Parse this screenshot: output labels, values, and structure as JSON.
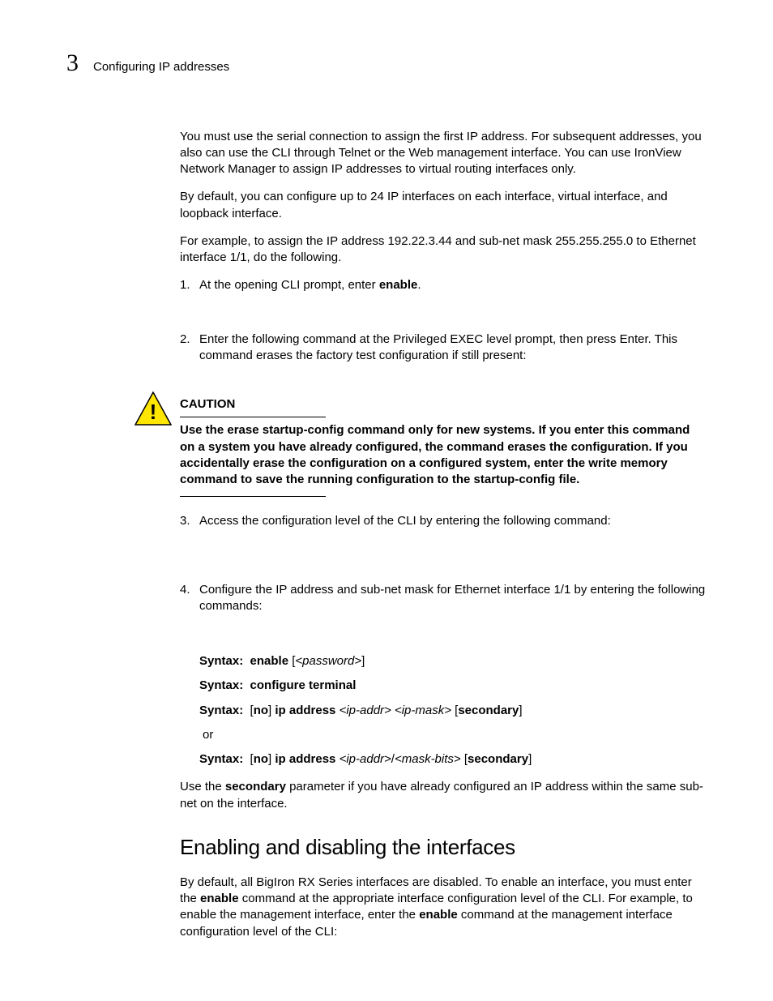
{
  "header": {
    "chapter_number": "3",
    "chapter_title": "Configuring IP addresses"
  },
  "body": {
    "p1": "You must use the serial connection to assign the first IP address. For subsequent addresses, you also can use the CLI through Telnet or the Web management interface. You can use IronView Network Manager to assign IP addresses to virtual routing interfaces only.",
    "p2": "By default, you can configure up to 24 IP interfaces on each interface, virtual interface, and loopback interface.",
    "p3": "For example, to assign the IP address 192.22.3.44 and sub-net mask 255.255.255.0 to Ethernet interface 1/1, do the following.",
    "steps": {
      "s1_num": "1.",
      "s1_a": "At the opening CLI prompt, enter ",
      "s1_b": "enable",
      "s1_c": ".",
      "s2_num": "2.",
      "s2": "Enter the following command at the Privileged EXEC level prompt, then press Enter. This command erases the factory test configuration if still present:",
      "s3_num": "3.",
      "s3": "Access the configuration level of the CLI by entering the following command:",
      "s4_num": "4.",
      "s4": "Configure the IP address and sub-net mask for Ethernet interface 1/1 by entering the following commands:"
    },
    "caution": {
      "label": "CAUTION",
      "text": "Use the erase startup-config command only for new systems. If you enter this command on a system you have already configured, the command erases the configuration. If you accidentally erase the configuration on a configured system, enter the write memory command to save the running configuration to the startup-config file."
    },
    "syntax": {
      "label": "Syntax:",
      "s1_a": "enable",
      "s1_b": " [",
      "s1_c": "<password>",
      "s1_d": "]",
      "s2": "configure terminal",
      "s3_a": "[",
      "s3_b": "no",
      "s3_c": "] ",
      "s3_d": "ip address",
      "s3_e": " ",
      "s3_f": "<ip-addr> <ip-mask>",
      "s3_g": " [",
      "s3_h": "secondary",
      "s3_i": "]",
      "or": "or",
      "s4_a": "[",
      "s4_b": "no",
      "s4_c": "] ",
      "s4_d": "ip address",
      "s4_e": " ",
      "s4_f": "<ip-addr>",
      "s4_g": "/",
      "s4_h": "<mask-bits>",
      "s4_i": " [",
      "s4_j": "secondary",
      "s4_k": "]"
    },
    "p4_a": "Use the ",
    "p4_b": "secondary",
    "p4_c": " parameter if you have already configured an IP address within the same sub-net on the interface.",
    "h2": "Enabling and disabling the interfaces",
    "p5_a": "By default, all BigIron RX Series interfaces are disabled. To enable an interface, you must enter the ",
    "p5_b": "enable",
    "p5_c": " command at the appropriate interface configuration level of the CLI. For example, to enable the management interface, enter the ",
    "p5_d": "enable",
    "p5_e": " command at the management interface configuration level of the CLI:"
  }
}
